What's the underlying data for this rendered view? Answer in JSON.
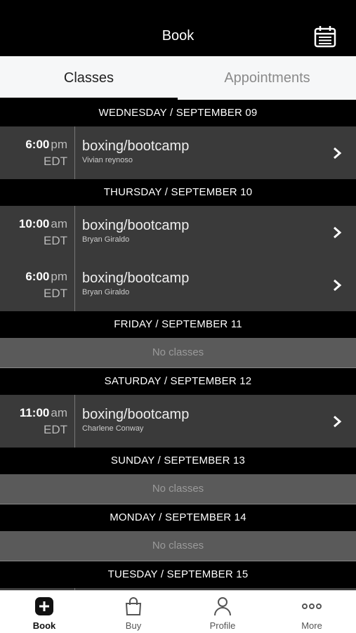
{
  "header": {
    "title": "Book",
    "calendar_icon": "calendar-icon"
  },
  "tabs": [
    {
      "label": "Classes",
      "active": true
    },
    {
      "label": "Appointments",
      "active": false
    }
  ],
  "days": [
    {
      "header": "WEDNESDAY / SEPTEMBER 09",
      "classes": [
        {
          "time": "6:00",
          "ampm": "pm",
          "tz": "EDT",
          "name": "boxing/bootcamp",
          "instructor": "Vivian reynoso"
        }
      ]
    },
    {
      "header": "THURSDAY / SEPTEMBER 10",
      "classes": [
        {
          "time": "10:00",
          "ampm": "am",
          "tz": "EDT",
          "name": "boxing/bootcamp",
          "instructor": "Bryan Giraldo"
        },
        {
          "time": "6:00",
          "ampm": "pm",
          "tz": "EDT",
          "name": "boxing/bootcamp",
          "instructor": "Bryan Giraldo"
        }
      ]
    },
    {
      "header": "FRIDAY / SEPTEMBER 11",
      "empty_text": "No classes"
    },
    {
      "header": "SATURDAY / SEPTEMBER 12",
      "classes": [
        {
          "time": "11:00",
          "ampm": "am",
          "tz": "EDT",
          "name": "boxing/bootcamp",
          "instructor": "Charlene Conway"
        }
      ]
    },
    {
      "header": "SUNDAY / SEPTEMBER 13",
      "empty_text": "No classes"
    },
    {
      "header": "MONDAY / SEPTEMBER 14",
      "empty_text": "No classes"
    },
    {
      "header": "TUESDAY / SEPTEMBER 15"
    }
  ],
  "tabbar": {
    "items": [
      {
        "label": "Book",
        "icon": "plus-square-icon",
        "active": true
      },
      {
        "label": "Buy",
        "icon": "shopping-bag-icon",
        "active": false
      },
      {
        "label": "Profile",
        "icon": "person-icon",
        "active": false
      },
      {
        "label": "More",
        "icon": "ellipsis-icon",
        "active": false
      }
    ]
  },
  "colors": {
    "header_bg": "#000000",
    "row_bg": "#3a3a3a",
    "empty_bg": "#5a5a5a",
    "tab_bg": "#f6f7f8"
  }
}
